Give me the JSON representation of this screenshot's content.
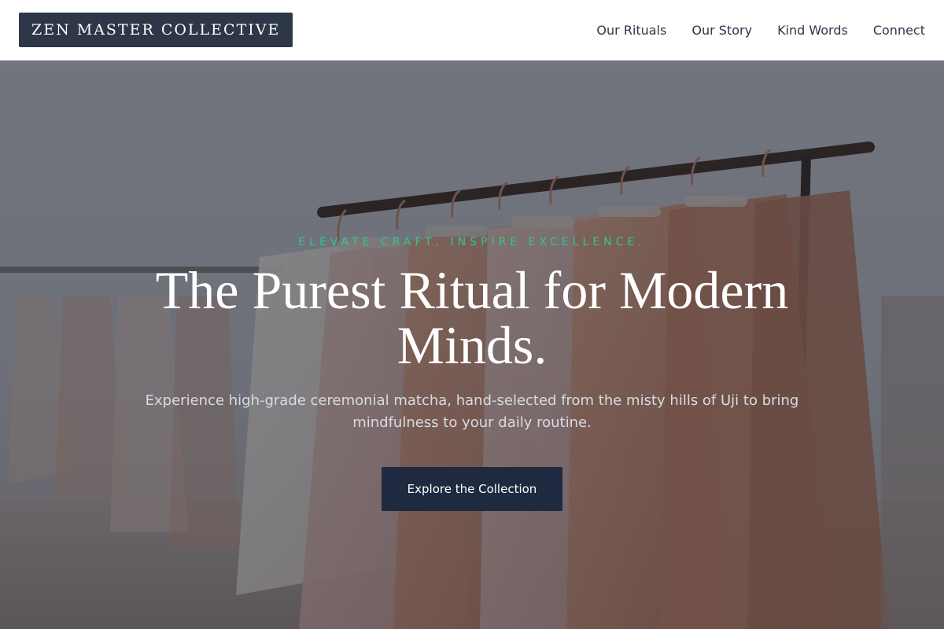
{
  "header": {
    "logo_text": "ZEN MASTER COLLECTIVE",
    "nav": [
      {
        "label": "Our Rituals"
      },
      {
        "label": "Our Story"
      },
      {
        "label": "Kind Words"
      },
      {
        "label": "Connect"
      }
    ]
  },
  "hero": {
    "eyebrow": "ELEVATE CRAFT, INSPIRE EXCELLENCE.",
    "headline": "The Purest Ritual for Modern Minds.",
    "subtext": "Experience high-grade ceremonial matcha, hand-selected from the misty hills of Uji to bring mindfulness to your daily routine.",
    "cta_label": "Explore the Collection",
    "background_image": "clothing-rack-photo"
  },
  "colors": {
    "header_bg": "#ffffff",
    "logo_bg": "#2d3748",
    "nav_text": "#2d3748",
    "eyebrow": "#34c58a",
    "headline": "#ffffff",
    "cta_bg": "#1f2a40"
  }
}
